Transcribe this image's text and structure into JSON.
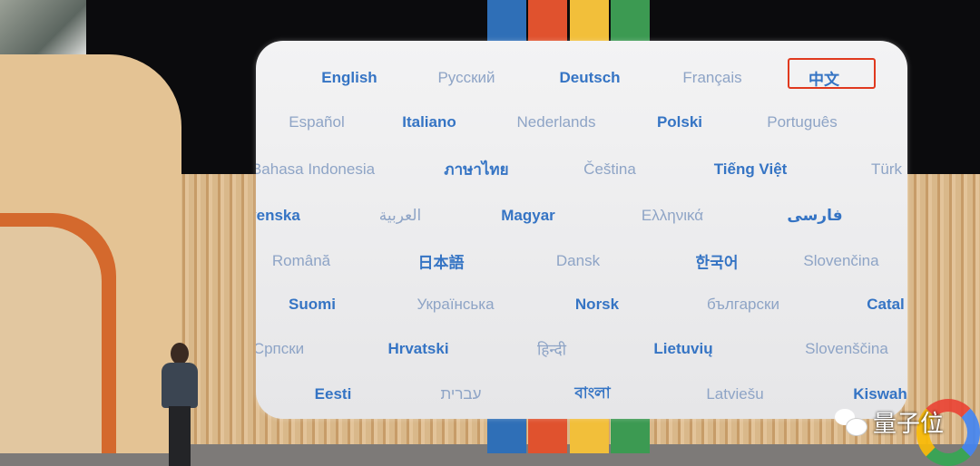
{
  "screen": {
    "highlighted_language": "中文",
    "rows": [
      [
        {
          "text": "English",
          "style": "bold"
        },
        {
          "text": "Русский",
          "style": "light"
        },
        {
          "text": "Deutsch",
          "style": "bold"
        },
        {
          "text": "Français",
          "style": "light"
        },
        {
          "text": "中文",
          "style": "bold"
        }
      ],
      [
        {
          "text": "Español",
          "style": "light"
        },
        {
          "text": "Italiano",
          "style": "bold"
        },
        {
          "text": "Nederlands",
          "style": "light"
        },
        {
          "text": "Polski",
          "style": "bold"
        },
        {
          "text": "Português",
          "style": "light"
        }
      ],
      [
        {
          "text": "Bahasa Indonesia",
          "style": "light"
        },
        {
          "text": "ภาษาไทย",
          "style": "bold"
        },
        {
          "text": "Čeština",
          "style": "light"
        },
        {
          "text": "Tiếng Việt",
          "style": "bold"
        },
        {
          "text": "Türk",
          "style": "light"
        }
      ],
      [
        {
          "text": "venska",
          "style": "bold"
        },
        {
          "text": "العربية",
          "style": "light"
        },
        {
          "text": "Magyar",
          "style": "bold"
        },
        {
          "text": "Ελληνικά",
          "style": "light"
        },
        {
          "text": "فارسی",
          "style": "bold"
        }
      ],
      [
        {
          "text": "Română",
          "style": "light"
        },
        {
          "text": "日本語",
          "style": "bold"
        },
        {
          "text": "Dansk",
          "style": "light"
        },
        {
          "text": "한국어",
          "style": "bold"
        },
        {
          "text": "Slovenčina",
          "style": "light"
        }
      ],
      [
        {
          "text": "Suomi",
          "style": "bold"
        },
        {
          "text": "Українська",
          "style": "light"
        },
        {
          "text": "Norsk",
          "style": "bold"
        },
        {
          "text": "български",
          "style": "light"
        },
        {
          "text": "Catal",
          "style": "bold"
        }
      ],
      [
        {
          "text": "Српски",
          "style": "light"
        },
        {
          "text": "Hrvatski",
          "style": "bold"
        },
        {
          "text": "हिन्दी",
          "style": "light"
        },
        {
          "text": "Lietuvių",
          "style": "bold"
        },
        {
          "text": "Slovenščina",
          "style": "light"
        }
      ],
      [
        {
          "text": "Eesti",
          "style": "bold"
        },
        {
          "text": "עברית",
          "style": "light"
        },
        {
          "text": "বাংলা",
          "style": "bold"
        },
        {
          "text": "Latviešu",
          "style": "light"
        },
        {
          "text": "Kiswah",
          "style": "bold"
        }
      ]
    ]
  },
  "watermark": {
    "text": "量子位",
    "icon": "wechat-icon"
  },
  "colors": {
    "bold_text": "#3574c4",
    "light_text": "#8ea4c6",
    "highlight_box": "#e0391e",
    "blue": "#2f6fb7",
    "red": "#e0522e",
    "yellow": "#f2bf3a",
    "green": "#3c9a52"
  }
}
